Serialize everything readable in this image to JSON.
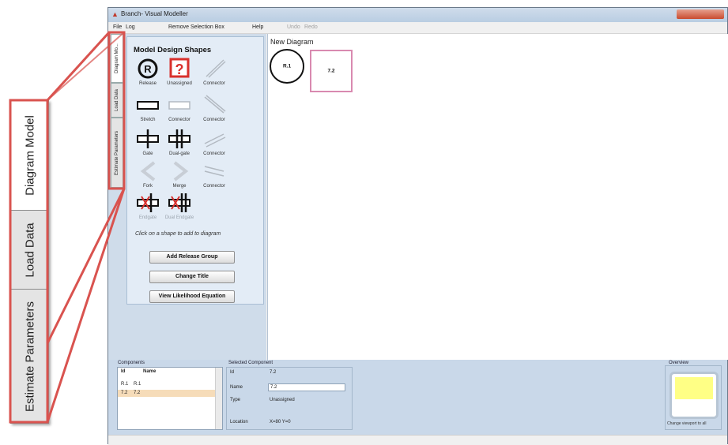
{
  "window": {
    "title": "Branch- Visual Modeller",
    "menu": [
      "File",
      "Log",
      "Remove Selection Box",
      "Help",
      "Undo",
      "Redo"
    ]
  },
  "zoom_tabs": [
    "Diagram Model",
    "Load Data",
    "Estimate Parameters"
  ],
  "side_tabs": [
    "Diagram Mo...",
    "Load Data",
    "Estimate Parameters"
  ],
  "shapes_panel": {
    "title": "Model Design Shapes",
    "shapes": [
      "Release",
      "Unassigned",
      "Connector",
      "Stretch",
      "Connector",
      "Connector",
      "Gate",
      "Dual-gate",
      "Connector",
      "Fork",
      "Merge",
      "Connector",
      "Endgate",
      "Dual Endgate"
    ],
    "hint": "Click on a shape to add to diagram",
    "buttons": [
      "Add Release Group",
      "Change Title",
      "View Likelihood Equation"
    ]
  },
  "diagram": {
    "title": "New Diagram",
    "nodes": [
      {
        "label": "R.1"
      },
      {
        "label": "7.2"
      }
    ]
  },
  "components": {
    "title": "Components",
    "headers": [
      "Id",
      "Name"
    ],
    "rows": [
      [
        "R.1",
        "R.1"
      ],
      [
        "7.2",
        "7.2"
      ]
    ]
  },
  "selected_component": {
    "title": "Selected Component",
    "labels": {
      "id": "Id",
      "name": "Name",
      "type": "Type",
      "location": "Location"
    },
    "id": "7.2",
    "name": "7.2",
    "type": "Unassigned",
    "location": "X=80 Y=0"
  },
  "overview": {
    "title": "Overview",
    "caption": "Change viewport to all"
  },
  "colors": {
    "callout": "#d9534f",
    "panel_bg": "#cfdcea",
    "overview_fill": "#ffff85",
    "node_72_border": "#d98ab0"
  }
}
